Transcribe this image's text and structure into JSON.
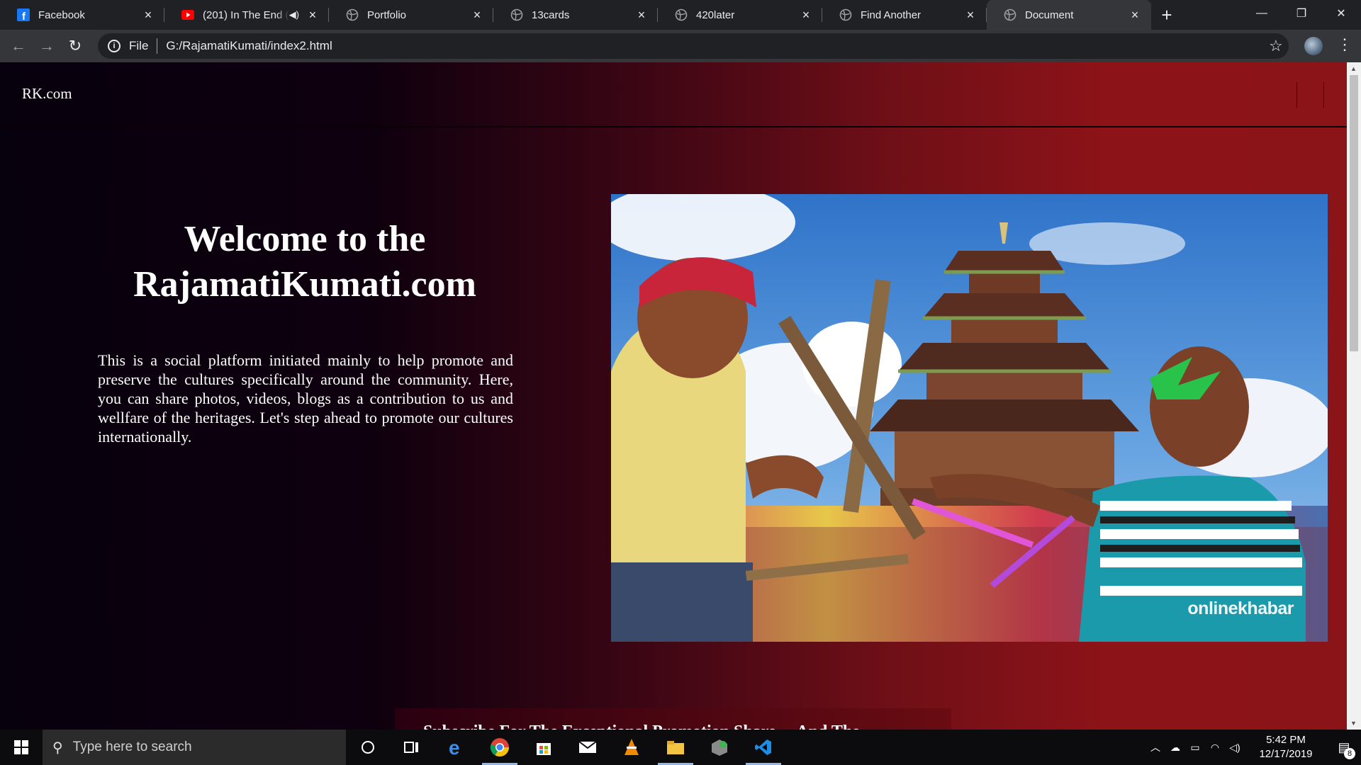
{
  "browser": {
    "tabs": [
      {
        "title": "Facebook",
        "icon": "facebook-icon",
        "active": false
      },
      {
        "title": "(201) In The End (C",
        "icon": "youtube-icon",
        "active": false,
        "audio": true
      },
      {
        "title": "Portfolio",
        "icon": "globe-icon",
        "active": false
      },
      {
        "title": "13cards",
        "icon": "globe-icon",
        "active": false
      },
      {
        "title": "420later",
        "icon": "globe-icon",
        "active": false
      },
      {
        "title": "Find Another",
        "icon": "globe-icon",
        "active": false
      },
      {
        "title": "Document",
        "icon": "globe-icon",
        "active": true
      }
    ],
    "address": {
      "scheme_label": "File",
      "url": "G:/RajamatiKumati/index2.html"
    }
  },
  "site": {
    "brand": "RK.com",
    "hero": {
      "title_line1": "Welcome to the",
      "title_line2": "RajamatiKumati.com",
      "description": "This is a social platform initiated mainly to help promote and preserve the cultures specifically around the community. Here, you can share photos, videos, blogs as a contribution to us and wellfare of the heritages. Let's step ahead to promote our cultures internationally."
    },
    "photo_watermark": "onlinekhabar",
    "subscribe_text": "Subscribe For The Exceptional Promotion Share ...  And The",
    "colors": {
      "gradient_left": "#07000d",
      "gradient_right": "#8b1418"
    }
  },
  "taskbar": {
    "search_placeholder": "Type here to search",
    "time": "5:42 PM",
    "date": "12/17/2019",
    "notification_count": "8"
  }
}
